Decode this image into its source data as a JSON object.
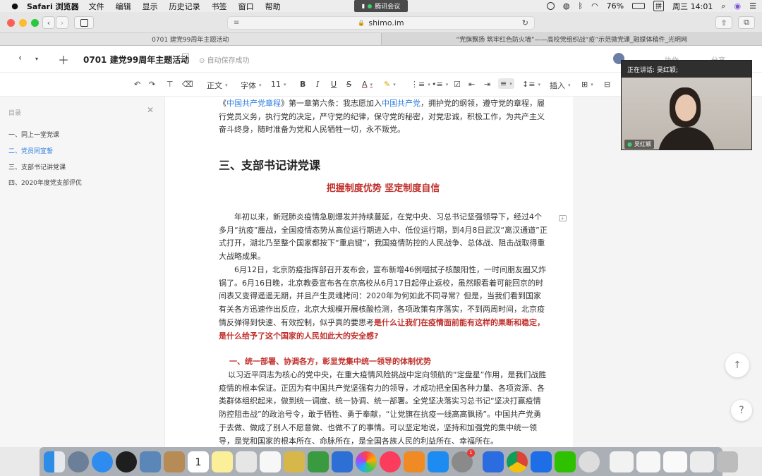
{
  "menubar": {
    "app_name": "Safari 浏览器",
    "items": [
      "文件",
      "编辑",
      "显示",
      "历史记录",
      "书签",
      "窗口",
      "帮助"
    ],
    "center_label": "腾讯会议",
    "battery": "76%",
    "input_method": "拼",
    "clock": "周三 14:01"
  },
  "browser": {
    "url": "shimo.im",
    "tabs": [
      {
        "label": "0701 建党99周年主题活动",
        "active": true
      },
      {
        "label": "“党旗飘扬 筑牢红色防火墙”——高校党组织战“疫”示范微党课_融媒体稿件_光明网",
        "active": false
      }
    ]
  },
  "doc": {
    "title": "0701 建党99周年主题活动",
    "save_status": "自动保存成功",
    "header_right": [
      "协作",
      "分享"
    ]
  },
  "format_toolbar": {
    "style": "正文",
    "font": "字体",
    "size": "11",
    "insert": "插入"
  },
  "toc": {
    "header": "目录",
    "items": [
      {
        "label": "一、同上一堂党课",
        "active": false
      },
      {
        "label": "二、党员同宣誓",
        "active": true
      },
      {
        "label": "三、支部书记讲党课",
        "active": false
      },
      {
        "label": "四、2020年度党支部评优",
        "active": false
      }
    ]
  },
  "content": {
    "p1_prefix": "《",
    "p1_link1": "中国共产党章程",
    "p1_mid": "》第一章第六条：我志愿加入",
    "p1_link2": "中国共产党",
    "p1_rest": "，拥护党的纲领，遵守党的章程，履行党员义务，执行党的决定，严守党的纪律，保守党的秘密，对党忠诚，积极工作，为共产主义奋斗终身，随时准备为党和人民牺牲一切，永不叛党。",
    "h2": "三、支部书记讲党课",
    "h_center": "把握制度优势 坚定制度自信",
    "p2": "年初以来，新冠肺炎疫情急剧爆发并持续蔓延，在党中央、习总书记坚强领导下，经过4个多月“抗疫”鏖战，全国疫情态势从高位运行期进入中、低位运行期，到4月8日武汉“离汉通道”正式打开，湖北乃至整个国家都按下“重启键”，我国疫情防控的人民战争、总体战、阻击战取得重大战略成果。",
    "p3_plain": "6月12日，北京防疫指挥部召开发布会，宣布新增46例咽拭子核酸阳性，一时间朋友圈又炸锅了。6月16日晚，北京教委宣布各在京高校从6月17日起停止返校，虽然眼看着可能回京的时间表又变得遥遥无期，并且产生灵魂拷问：2020年为何如此不同寻常？但是，当我们看到国家有关各方迅速作出反应，北京大规模开展核酸检测，各项政策有序落实，不到两周时间，北京疫情反弹得到快速、有效控制，似乎真的要思考",
    "p3_red": "是什么让我们在疫情面前能有这样的果断和稳定，是什么给予了这个国家的人民如此大的安全感?",
    "h3": "一、统一部署、协调各方，彰显党集中统一领导的体制优势",
    "p4": "以习近平同志为核心的党中央，在重大疫情风险挑战中定向领航的“定盘星”作用，是我们战胜疫情的根本保证。正因为有中国共产党坚强有力的领导，才成功把全国各种力量、各项资源、各类群体组织起来，做到统一调度、统一协调、统一部署。全党坚决落实习总书记“坚决打赢疫情防控阻击战”的政治号令，敢于牺牲、勇于奉献，“让党旗在抗疫一线高高飘扬”。中国共产党勇于去做、做成了别人不愿意做、也做不了的事情。可以坚定地说，坚持和加强党的集中统一领导，是党和国家的根本所在、命脉所在，是全国各族人民的利益所在、幸福所在。"
  },
  "meeting": {
    "speaking_label": "正在讲话: 吴红颖;",
    "participant_name": "吴红颖"
  },
  "dock": {
    "calendar_day": "1",
    "badge_count": "1"
  },
  "colors": {
    "accent": "#2f7fe0",
    "heading_red": "#c0302c"
  }
}
